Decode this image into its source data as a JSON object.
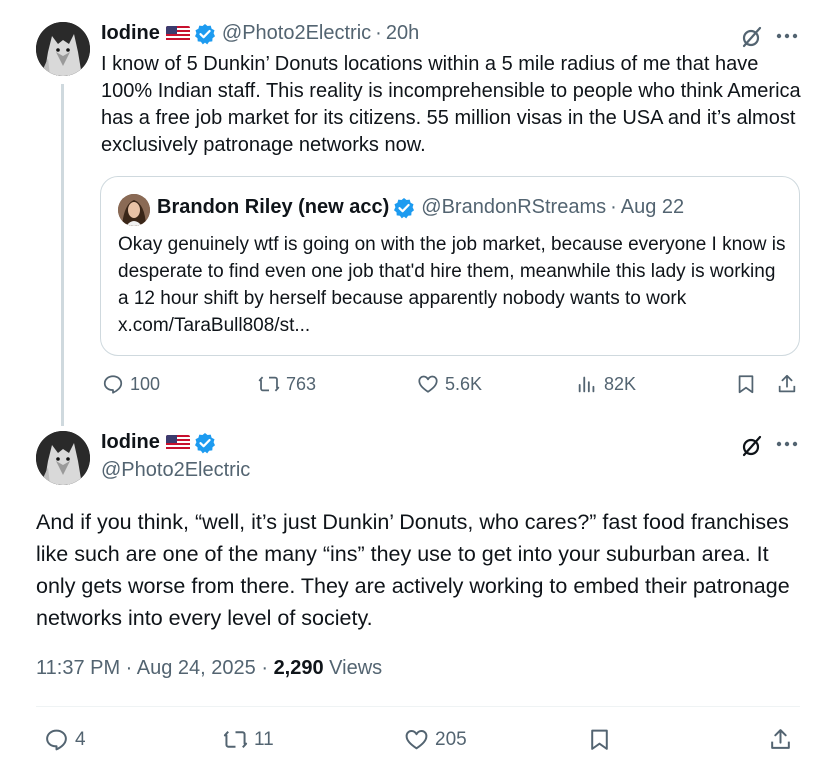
{
  "colors": {
    "text": "#0f1419",
    "secondary": "#536471",
    "verified": "#1d9bf0",
    "border": "#cfd9de",
    "line": "#eff3f4"
  },
  "tweet1": {
    "name": "Iodine",
    "flag_icon": "us-flag-icon",
    "handle": "@Photo2Electric",
    "separator": "·",
    "time": "20h",
    "text": "I know of 5 Dunkin’ Donuts locations within a 5 mile radius of me that have 100% Indian staff. This reality is incomprehensible to people who think America has a free job market for its citizens. 55 million visas in the USA and it’s almost exclusively patronage networks now.",
    "quote": {
      "name": "Brandon Riley (new acc)",
      "handle": "@BrandonRStreams",
      "separator": "·",
      "time": "Aug 22",
      "text": "Okay genuinely wtf is going on with the job market, because everyone I know is desperate to find even one job that'd hire them, meanwhile this lady is working a 12 hour shift by herself because apparently nobody wants to work x.com/TaraBull808/st..."
    },
    "actions": {
      "replies": "100",
      "reposts": "763",
      "likes": "5.6K",
      "views": "82K"
    }
  },
  "tweet2": {
    "name": "Iodine",
    "flag_icon": "us-flag-icon",
    "handle": "@Photo2Electric",
    "text": "And if you think, “well, it’s just Dunkin’ Donuts, who cares?” fast food franchises like such are one of the many “ins” they use to get into your suburban area. It only gets worse from there. They are actively working to embed their patronage networks into every level of society.",
    "timestamp": "11:37 PM · Aug 24, 2025 · ",
    "views_count": "2,290",
    "views_label": " Views",
    "actions": {
      "replies": "4",
      "reposts": "11",
      "likes": "205"
    }
  }
}
